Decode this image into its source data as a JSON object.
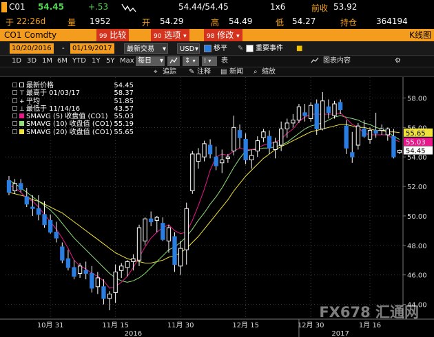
{
  "quote": {
    "ticker": "C01",
    "last": "54.45",
    "change": "+.53",
    "bid_ask": "54.44/54.45",
    "size": "1x6",
    "prev_close_label": "前收",
    "prev_close": "53.92",
    "time_prefix": "于",
    "time": "22:26d",
    "volume_label": "量",
    "volume": "1952",
    "open_label": "开",
    "open": "54.29",
    "high_label": "高",
    "high": "54.49",
    "low_label": "低",
    "low": "54.27",
    "oi_label": "持仓",
    "oi": "364194"
  },
  "header": {
    "security": "CO1 Comdty",
    "compare_num": "99",
    "compare_label": "比较",
    "options_num": "90",
    "options_label": "选项",
    "edit_num": "98",
    "edit_label": "修改",
    "chart_title": "K线图"
  },
  "toolbar": {
    "start_date": "10/20/2016",
    "end_date": "01/19/2017",
    "price_type": "最新交易",
    "currency": "USD",
    "smooth_label": "移平",
    "events_label": "重要事件"
  },
  "periods": {
    "items": [
      "1D",
      "3D",
      "1M",
      "6M",
      "YTD",
      "1Y",
      "5Y",
      "Max"
    ],
    "frequency": "每日",
    "table_label": "表",
    "chart_contents": "图表内容"
  },
  "tools": {
    "track": "追踪",
    "annotate": "注释",
    "news": "新闻",
    "zoom": "缩放"
  },
  "legend": [
    {
      "label": "最新价格",
      "value": "54.45",
      "color": "#ffffff",
      "marker": "box"
    },
    {
      "label": "最高于 01/03/17",
      "value": "58.37",
      "color": "#ffffff",
      "marker": "high"
    },
    {
      "label": "平均",
      "value": "51.85",
      "color": "#ffffff",
      "marker": "avg"
    },
    {
      "label": "最低于 11/14/16",
      "value": "43.57",
      "color": "#ffffff",
      "marker": "low"
    },
    {
      "label": "SMAVG (5) 收盘值 (CO1)",
      "value": "55.03",
      "color": "#e8178a",
      "marker": "box"
    },
    {
      "label": "SMAVG (10) 收盘值 (CO1)",
      "value": "55.19",
      "color": "#8fe07a",
      "marker": "box"
    },
    {
      "label": "SMAVG (20) 收盘值 (CO1)",
      "value": "55.65",
      "color": "#f0e23b",
      "marker": "box"
    }
  ],
  "watermark": "FX678 汇通网",
  "chart_data": {
    "type": "candlestick",
    "ylim": [
      43,
      59
    ],
    "yticks": [
      44,
      46,
      48,
      50,
      52,
      54,
      56,
      58
    ],
    "x_tick_labels": [
      "10月 31",
      "11月 15",
      "11月 30",
      "12月 15",
      "12月 30",
      "1月 16"
    ],
    "x_year_labels": [
      "2016",
      "2017"
    ],
    "price_tags": [
      {
        "value": 55.65,
        "color": "#f0e23b"
      },
      {
        "value": 55.03,
        "color": "#e8178a"
      },
      {
        "value": 54.45,
        "color": "#ffffff"
      }
    ],
    "candles": [
      [
        52.4,
        52.7,
        51.4,
        51.6
      ],
      [
        51.7,
        52.5,
        51.5,
        52.2
      ],
      [
        52.2,
        52.5,
        51.6,
        51.8
      ],
      [
        51.3,
        51.9,
        50.6,
        50.8
      ],
      [
        50.6,
        51.4,
        50.0,
        50.5
      ],
      [
        50.5,
        51.4,
        49.7,
        50.1
      ],
      [
        50.1,
        51.0,
        49.2,
        49.4
      ],
      [
        49.7,
        50.1,
        48.8,
        48.9
      ],
      [
        48.9,
        49.6,
        48.2,
        48.5
      ],
      [
        47.9,
        48.2,
        46.8,
        47.0
      ],
      [
        47.1,
        47.7,
        46.3,
        46.5
      ],
      [
        46.5,
        47.0,
        45.7,
        45.9
      ],
      [
        46.1,
        46.8,
        45.8,
        46.6
      ],
      [
        46.3,
        46.9,
        45.7,
        46.1
      ],
      [
        46.1,
        46.6,
        44.8,
        45.1
      ],
      [
        45.2,
        46.2,
        44.7,
        45.8
      ],
      [
        45.2,
        45.7,
        44.0,
        44.4
      ],
      [
        44.4,
        44.9,
        43.6,
        44.7
      ],
      [
        44.8,
        46.7,
        44.1,
        46.2
      ],
      [
        46.3,
        46.8,
        45.8,
        46.6
      ],
      [
        46.5,
        47.0,
        45.9,
        46.9
      ],
      [
        46.9,
        47.4,
        46.3,
        47.1
      ],
      [
        47.0,
        49.4,
        46.6,
        49.2
      ],
      [
        48.3,
        49.9,
        48.0,
        49.8
      ],
      [
        49.8,
        50.3,
        49.3,
        49.6
      ],
      [
        49.7,
        50.0,
        48.9,
        49.9
      ],
      [
        49.5,
        49.9,
        48.3,
        48.4
      ],
      [
        48.3,
        49.4,
        47.5,
        49.2
      ],
      [
        48.6,
        48.9,
        46.2,
        46.7
      ],
      [
        46.6,
        48.3,
        46.0,
        47.8
      ],
      [
        47.7,
        50.9,
        46.7,
        50.5
      ],
      [
        51.7,
        54.4,
        51.5,
        54.2
      ],
      [
        53.7,
        54.6,
        53.2,
        54.2
      ],
      [
        54.0,
        55.1,
        53.7,
        54.9
      ],
      [
        54.8,
        55.2,
        53.9,
        54.2
      ],
      [
        54.0,
        54.7,
        53.1,
        53.4
      ],
      [
        53.6,
        54.5,
        52.9,
        53.8
      ],
      [
        53.9,
        54.2,
        53.6,
        54.0
      ],
      [
        54.4,
        56.8,
        54.1,
        56.0
      ],
      [
        55.8,
        56.2,
        54.6,
        55.3
      ],
      [
        55.2,
        55.6,
        53.5,
        53.8
      ],
      [
        53.8,
        54.5,
        53.2,
        54.1
      ],
      [
        54.4,
        55.4,
        54.0,
        55.1
      ],
      [
        55.3,
        55.9,
        55.0,
        55.7
      ],
      [
        55.4,
        55.8,
        54.2,
        54.6
      ],
      [
        54.5,
        55.3,
        53.9,
        55.0
      ],
      [
        54.8,
        56.4,
        54.4,
        55.9
      ],
      [
        55.9,
        56.6,
        55.3,
        56.3
      ],
      [
        56.3,
        56.9,
        56.0,
        56.5
      ],
      [
        56.5,
        57.6,
        56.3,
        57.4
      ],
      [
        57.0,
        57.6,
        56.4,
        56.8
      ],
      [
        56.6,
        57.7,
        56.4,
        57.5
      ],
      [
        57.6,
        57.9,
        55.5,
        55.9
      ],
      [
        55.9,
        58.4,
        55.8,
        57.8
      ],
      [
        57.4,
        57.9,
        56.6,
        57.0
      ],
      [
        56.8,
        57.8,
        56.6,
        57.6
      ],
      [
        57.7,
        57.9,
        56.9,
        57.2
      ],
      [
        56.1,
        56.5,
        54.2,
        54.6
      ],
      [
        54.3,
        55.7,
        53.6,
        54.0
      ],
      [
        54.8,
        56.3,
        54.5,
        56.1
      ],
      [
        55.9,
        56.5,
        55.3,
        55.4
      ],
      [
        55.2,
        56.0,
        54.9,
        55.8
      ],
      [
        55.8,
        57.0,
        55.3,
        55.6
      ],
      [
        55.8,
        56.2,
        55.5,
        55.9
      ],
      [
        55.5,
        56.0,
        55.1,
        55.9
      ],
      [
        55.4,
        55.9,
        53.9,
        54.0
      ],
      [
        54.3,
        54.5,
        54.2,
        54.45
      ]
    ],
    "sma5": [
      52.1,
      51.9,
      51.6,
      51.2,
      51.0,
      50.6,
      50.1,
      49.6,
      49.1,
      48.5,
      47.8,
      47.0,
      46.6,
      46.4,
      46.1,
      45.9,
      45.6,
      45.1,
      45.2,
      45.5,
      45.9,
      46.5,
      47.2,
      47.9,
      48.5,
      48.9,
      49.2,
      49.4,
      49.0,
      48.8,
      48.9,
      49.7,
      50.7,
      51.8,
      53.1,
      54.0,
      54.2,
      54.1,
      54.4,
      54.6,
      54.5,
      54.5,
      54.6,
      54.8,
      54.9,
      55.0,
      55.2,
      55.6,
      55.9,
      56.4,
      56.7,
      56.9,
      56.9,
      56.9,
      56.9,
      56.9,
      57.0,
      56.6,
      56.2,
      56.0,
      55.6,
      55.5,
      55.5,
      55.5,
      55.5,
      55.2,
      55.03
    ],
    "sma10": [
      52.4,
      52.2,
      51.9,
      51.6,
      51.3,
      51.0,
      50.7,
      50.4,
      50.0,
      49.5,
      49.0,
      48.5,
      48.1,
      47.7,
      47.3,
      46.9,
      46.5,
      46.1,
      45.8,
      45.6,
      45.5,
      45.6,
      45.8,
      46.1,
      46.5,
      46.9,
      47.3,
      47.7,
      47.9,
      48.2,
      48.6,
      49.1,
      49.7,
      50.2,
      50.8,
      51.3,
      51.9,
      52.6,
      53.3,
      53.9,
      54.4,
      54.5,
      54.5,
      54.6,
      54.6,
      54.7,
      54.8,
      55.0,
      55.3,
      55.6,
      55.9,
      56.1,
      56.2,
      56.3,
      56.5,
      56.7,
      56.8,
      56.7,
      56.6,
      56.5,
      56.3,
      56.2,
      56.0,
      55.9,
      55.7,
      55.4,
      55.19
    ],
    "sma20": [
      51.6,
      51.5,
      51.4,
      51.3,
      51.1,
      51.0,
      50.8,
      50.6,
      50.4,
      50.2,
      49.9,
      49.6,
      49.3,
      49.0,
      48.7,
      48.4,
      48.1,
      47.8,
      47.5,
      47.3,
      47.1,
      47.0,
      46.9,
      46.8,
      46.8,
      46.9,
      47.0,
      47.2,
      47.3,
      47.5,
      47.8,
      48.2,
      48.6,
      49.1,
      49.6,
      50.1,
      50.6,
      51.1,
      51.7,
      52.2,
      52.7,
      53.1,
      53.5,
      53.9,
      54.2,
      54.5,
      54.7,
      54.9,
      55.1,
      55.3,
      55.5,
      55.7,
      55.8,
      55.9,
      56.0,
      56.1,
      56.2,
      56.2,
      56.1,
      56.0,
      56.0,
      55.9,
      55.8,
      55.8,
      55.7,
      55.7,
      55.65
    ]
  }
}
